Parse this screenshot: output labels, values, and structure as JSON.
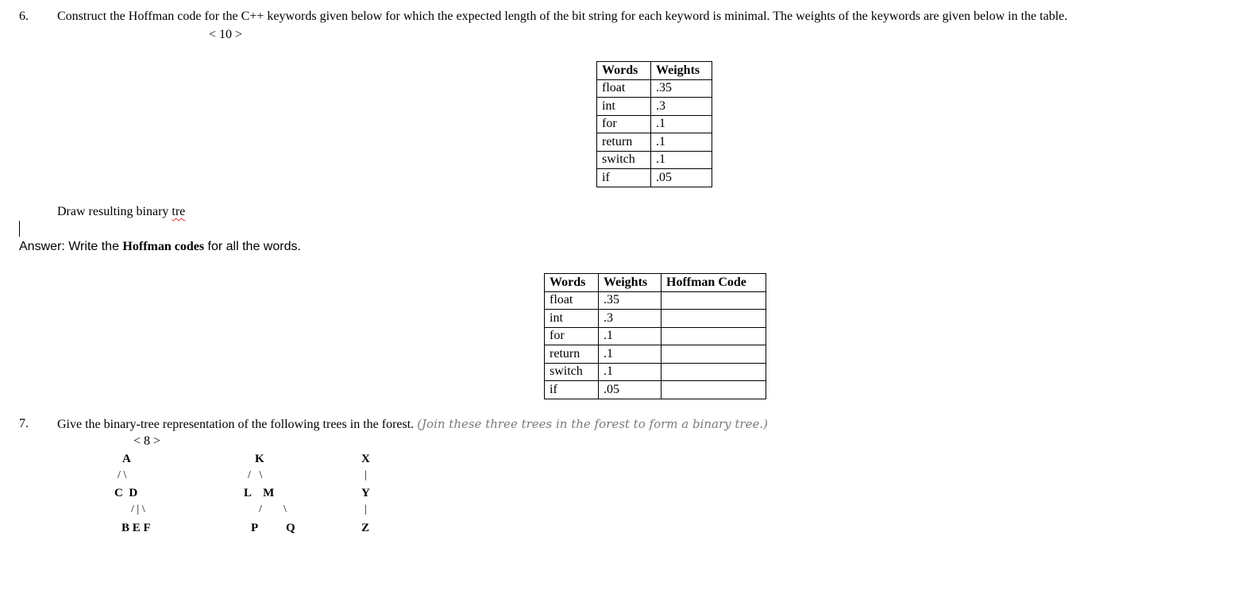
{
  "q6": {
    "number": "6.",
    "text": "Construct the Hoffman code for the C++ keywords given below for which the expected length of the bit string for each keyword is minimal. The weights of the keywords are given below in the table.",
    "marks": "< 10 >",
    "table1": {
      "headers": [
        "Words",
        "Weights"
      ],
      "rows": [
        [
          "float",
          ".35"
        ],
        [
          "int",
          ".3"
        ],
        [
          "for",
          ".1"
        ],
        [
          "return",
          ".1"
        ],
        [
          "switch",
          ".1"
        ],
        [
          "if",
          ".05"
        ]
      ]
    },
    "draw_prefix": "Draw resulting binary ",
    "draw_misspelled": "tre",
    "answer_prefix": "Answer: Write the ",
    "answer_bold": "Hoffman codes",
    "answer_suffix": " for all the words.",
    "table2": {
      "headers": [
        "Words",
        "Weights",
        "Hoffman Code"
      ],
      "rows": [
        [
          "float",
          ".35",
          ""
        ],
        [
          "int",
          ".3",
          ""
        ],
        [
          "for",
          ".1",
          ""
        ],
        [
          "return",
          ".1",
          ""
        ],
        [
          "switch",
          ".1",
          ""
        ],
        [
          "if",
          ".05",
          ""
        ]
      ]
    }
  },
  "q7": {
    "number": "7.",
    "text": "Give the binary-tree representation of the following trees in the forest.",
    "hint": "(Join these three trees in the forest to form a binary tree.)",
    "marks": "< 8 >",
    "trees": {
      "tree1": {
        "root": "A",
        "level1_edges": "/ \\",
        "level1": "C  D",
        "level2_edges": "/ | \\",
        "level2": "B E F"
      },
      "tree2": {
        "root": "K",
        "level1_edges": "/   \\",
        "level1": "L    M",
        "level2_edges_left": "/",
        "level2_edges_right": "\\",
        "level2_left": "P",
        "level2_right": "Q"
      },
      "tree3": {
        "root": "X",
        "edge1": "|",
        "level1": "Y",
        "edge2": "|",
        "level2": "Z"
      }
    }
  }
}
